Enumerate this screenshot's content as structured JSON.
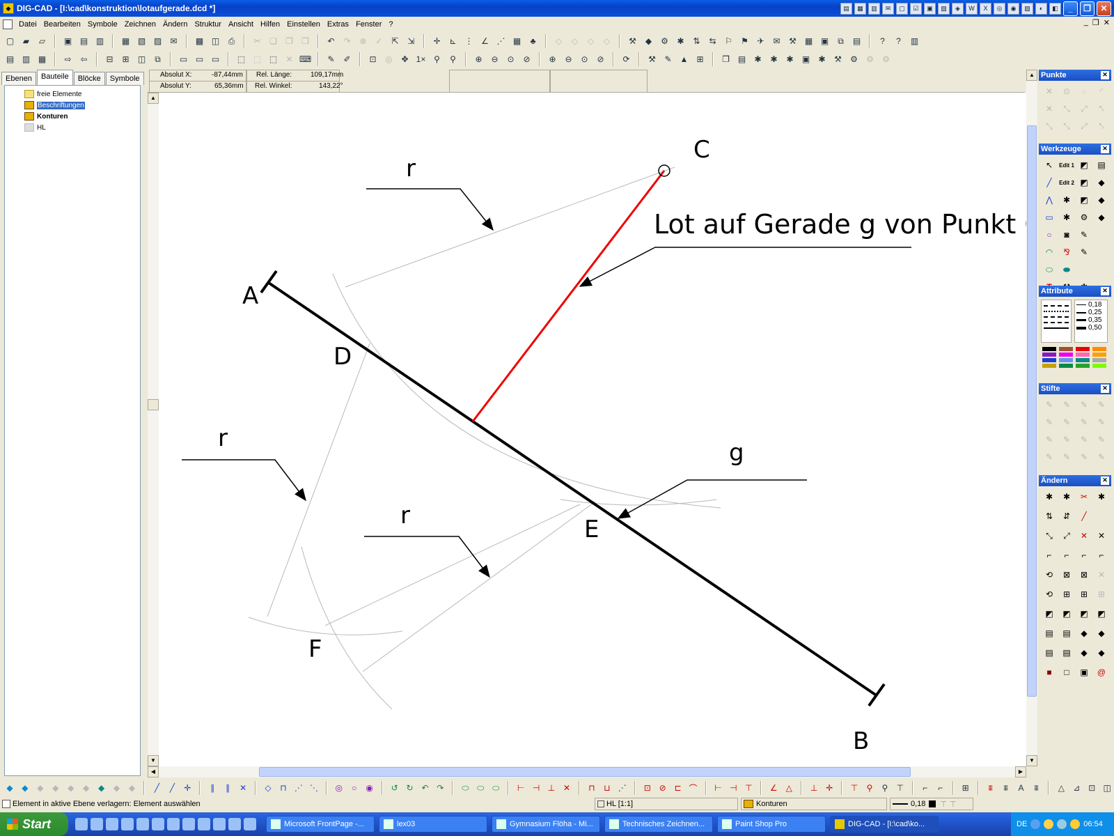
{
  "window": {
    "title": "DIG-CAD - [I:\\cad\\konstruktion\\lotaufgerade.dcd *]"
  },
  "menu": [
    "Datei",
    "Bearbeiten",
    "Symbole",
    "Zeichnen",
    "Ändern",
    "Struktur",
    "Ansicht",
    "Hilfen",
    "Einstellen",
    "Extras",
    "Fenster",
    "?"
  ],
  "left_panel": {
    "tabs": [
      "Ebenen",
      "Bauteile",
      "Blöcke",
      "Symbole"
    ],
    "active_tab": "Bauteile",
    "tree": [
      {
        "label": "freie Elemente",
        "icon": "folder-icon"
      },
      {
        "label": "Beschriftungen",
        "icon": "tools-icon",
        "selected": true
      },
      {
        "label": "Konturen",
        "icon": "tools-icon",
        "bold": true
      },
      {
        "label": "HL",
        "icon": "ghost-icon"
      }
    ]
  },
  "coords": {
    "abs_x_label": "Absolut X:",
    "abs_x": "-87,44mm",
    "abs_y_label": "Absolut Y:",
    "abs_y": "65,36mm",
    "rel_len_label": "Rel. Länge:",
    "rel_len": "109,17mm",
    "rel_ang_label": "Rel. Winkel:",
    "rel_ang": "143,22°"
  },
  "drawing": {
    "labels": {
      "A": "A",
      "B": "B",
      "C": "C",
      "D": "D",
      "E": "E",
      "F": "F",
      "g": "g",
      "r1": "r",
      "r2": "r",
      "r3": "r"
    },
    "annotation": "Lot auf Gerade g von Punkt C",
    "colors": {
      "line": "#000000",
      "perpendicular": "#ee0000",
      "construction": "#b8b8b8"
    }
  },
  "right_panels": {
    "punkte": "Punkte",
    "werkzeuge": "Werkzeuge",
    "attribute": "Attribute",
    "stifte": "Stifte",
    "aendern": "Ändern",
    "line_widths": [
      "0,18",
      "0,25",
      "0,35",
      "0,50"
    ],
    "edit_labels": [
      "Edit 1",
      "Edit 2"
    ]
  },
  "status": {
    "message": "Element in aktive Ebene verlagern: Element auswählen",
    "layer": "HL [1:1]",
    "group": "Konturen",
    "pen": "0,18"
  },
  "taskbar": {
    "start": "Start",
    "tasks": [
      "Microsoft FrontPage -...",
      "lex03",
      "Gymnasium Flöha - Mi...",
      "Technisches Zeichnen...",
      "Paint Shop Pro",
      "DIG-CAD - [I:\\cad\\ko..."
    ],
    "lang": "DE",
    "clock": "06:54"
  }
}
